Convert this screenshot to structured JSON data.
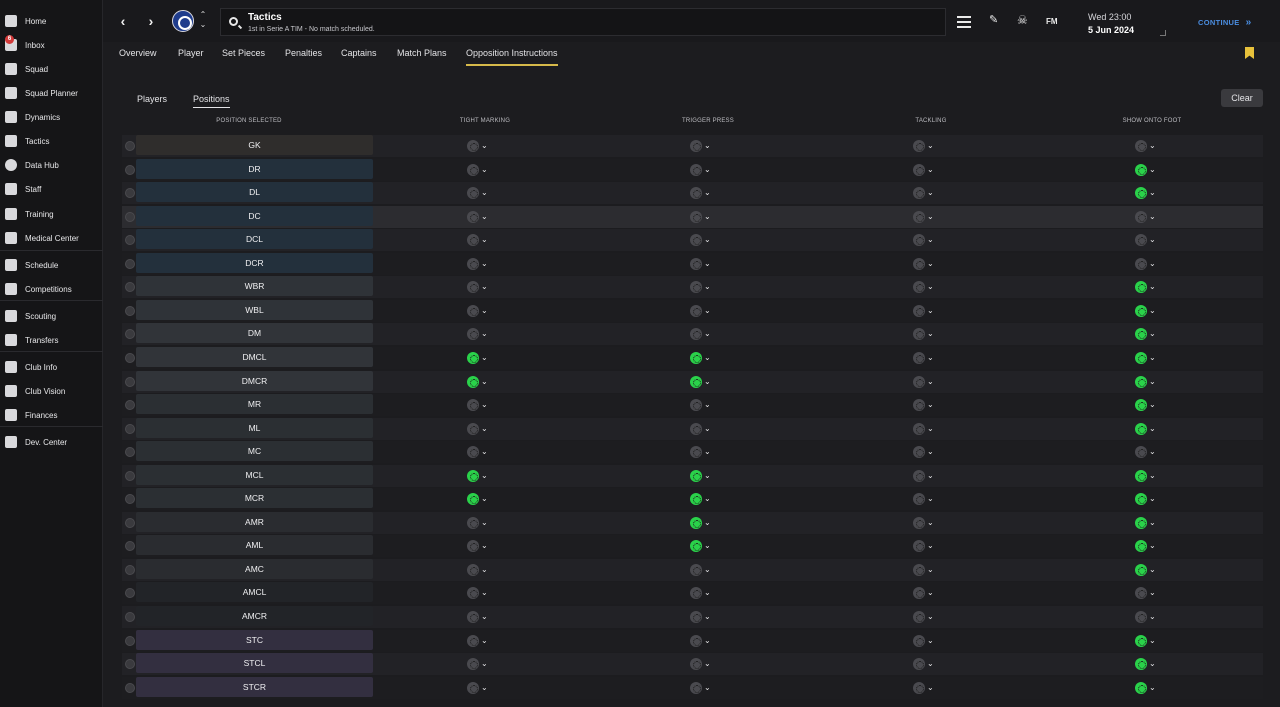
{
  "sidebar": {
    "items": [
      {
        "label": "Home",
        "icon": "home-icon"
      },
      {
        "label": "Inbox",
        "icon": "inbox-icon",
        "badge": "6"
      },
      {
        "label": "Squad",
        "icon": "shirt-icon"
      },
      {
        "label": "Squad Planner",
        "icon": "planner-icon"
      },
      {
        "label": "Dynamics",
        "icon": "dynamics-icon"
      },
      {
        "label": "Tactics",
        "icon": "tactics-icon"
      },
      {
        "label": "Data Hub",
        "icon": "data-hub-icon"
      },
      {
        "label": "Staff",
        "icon": "staff-icon"
      },
      {
        "label": "Training",
        "icon": "training-icon"
      },
      {
        "label": "Medical Center",
        "icon": "medical-icon"
      },
      {
        "label": "Schedule",
        "icon": "calendar-icon"
      },
      {
        "label": "Competitions",
        "icon": "trophy-icon"
      },
      {
        "label": "Scouting",
        "icon": "scouting-icon"
      },
      {
        "label": "Transfers",
        "icon": "transfers-icon"
      },
      {
        "label": "Club Info",
        "icon": "shield-icon"
      },
      {
        "label": "Club Vision",
        "icon": "vision-icon"
      },
      {
        "label": "Finances",
        "icon": "finances-icon"
      },
      {
        "label": "Dev. Center",
        "icon": "dev-center-icon"
      }
    ]
  },
  "header": {
    "title": "Tactics",
    "subtitle": "1st in Serie A TIM - No match scheduled.",
    "fm_label": "FM",
    "date_line1": "Wed 23:00",
    "date_line2": "5 Jun 2024",
    "continue_label": "CONTINUE"
  },
  "tabs": [
    "Overview",
    "Player",
    "Set Pieces",
    "Penalties",
    "Captains",
    "Match Plans",
    "Opposition Instructions"
  ],
  "active_tab": "Opposition Instructions",
  "subtabs": [
    "Players",
    "Positions"
  ],
  "active_subtab": "Positions",
  "clear_label": "Clear",
  "columns": [
    "POSITION SELECTED",
    "TIGHT MARKING",
    "TRIGGER PRESS",
    "TACKLING",
    "SHOW ONTO FOOT"
  ],
  "accent_color": "#2ad24a",
  "rows": [
    {
      "pos": "GK",
      "group": "gk",
      "tight": false,
      "press": false,
      "tackle": false,
      "foot": false
    },
    {
      "pos": "DR",
      "group": "def",
      "tight": false,
      "press": false,
      "tackle": false,
      "foot": true
    },
    {
      "pos": "DL",
      "group": "def",
      "tight": false,
      "press": false,
      "tackle": false,
      "foot": true
    },
    {
      "pos": "DC",
      "group": "def",
      "tight": false,
      "press": false,
      "tackle": false,
      "foot": false
    },
    {
      "pos": "DCL",
      "group": "def",
      "tight": false,
      "press": false,
      "tackle": false,
      "foot": false
    },
    {
      "pos": "DCR",
      "group": "def",
      "tight": false,
      "press": false,
      "tackle": false,
      "foot": false
    },
    {
      "pos": "WBR",
      "group": "wb",
      "tight": false,
      "press": false,
      "tackle": false,
      "foot": true
    },
    {
      "pos": "WBL",
      "group": "wb",
      "tight": false,
      "press": false,
      "tackle": false,
      "foot": true
    },
    {
      "pos": "DM",
      "group": "mid",
      "tight": false,
      "press": false,
      "tackle": false,
      "foot": true
    },
    {
      "pos": "DMCL",
      "group": "mid",
      "tight": true,
      "press": true,
      "tackle": false,
      "foot": true
    },
    {
      "pos": "DMCR",
      "group": "mid",
      "tight": true,
      "press": true,
      "tackle": false,
      "foot": true
    },
    {
      "pos": "MR",
      "group": "wide",
      "tight": false,
      "press": false,
      "tackle": false,
      "foot": true
    },
    {
      "pos": "ML",
      "group": "wide",
      "tight": false,
      "press": false,
      "tackle": false,
      "foot": true
    },
    {
      "pos": "MC",
      "group": "wide",
      "tight": false,
      "press": false,
      "tackle": false,
      "foot": false
    },
    {
      "pos": "MCL",
      "group": "wide",
      "tight": true,
      "press": true,
      "tackle": false,
      "foot": true
    },
    {
      "pos": "MCR",
      "group": "wide",
      "tight": true,
      "press": true,
      "tackle": false,
      "foot": true
    },
    {
      "pos": "AMR",
      "group": "amc",
      "tight": false,
      "press": true,
      "tackle": false,
      "foot": true
    },
    {
      "pos": "AML",
      "group": "amc",
      "tight": false,
      "press": true,
      "tackle": false,
      "foot": true
    },
    {
      "pos": "AMC",
      "group": "amc",
      "tight": false,
      "press": false,
      "tackle": false,
      "foot": true
    },
    {
      "pos": "AMCL",
      "group": "am",
      "tight": false,
      "press": false,
      "tackle": false,
      "foot": false
    },
    {
      "pos": "AMCR",
      "group": "am",
      "tight": false,
      "press": false,
      "tackle": false,
      "foot": false
    },
    {
      "pos": "STC",
      "group": "st",
      "tight": false,
      "press": false,
      "tackle": false,
      "foot": true
    },
    {
      "pos": "STCL",
      "group": "st",
      "tight": false,
      "press": false,
      "tackle": false,
      "foot": true
    },
    {
      "pos": "STCR",
      "group": "st",
      "tight": false,
      "press": false,
      "tackle": false,
      "foot": true
    }
  ]
}
